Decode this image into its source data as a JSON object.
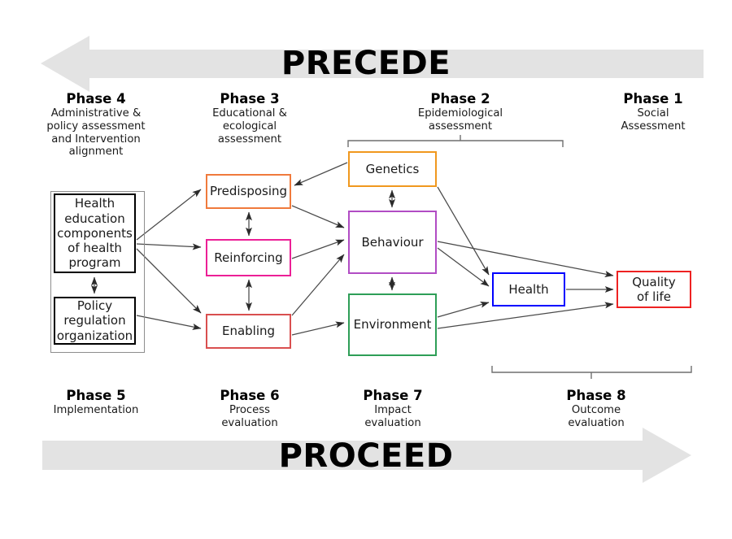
{
  "banners": {
    "top": {
      "label": "PRECEDE",
      "direction": "left",
      "color": "#e3e3e3"
    },
    "bottom": {
      "label": "PROCEED",
      "direction": "right",
      "color": "#e3e3e3"
    }
  },
  "phases_top": [
    {
      "title": "Phase 4",
      "subtitle": "Administrative &\npolicy assessment\nand Intervention\nalignment"
    },
    {
      "title": "Phase 3",
      "subtitle": "Educational &\necological\nassessment"
    },
    {
      "title": "Phase 2",
      "subtitle": "Epidemiological\nassessment"
    },
    {
      "title": "Phase 1",
      "subtitle": "Social\nAssessment"
    }
  ],
  "phases_bottom": [
    {
      "title": "Phase 5",
      "subtitle": "Implementation"
    },
    {
      "title": "Phase 6",
      "subtitle": "Process\nevaluation"
    },
    {
      "title": "Phase 7",
      "subtitle": "Impact\nevaluation"
    },
    {
      "title": "Phase 8",
      "subtitle": "Outcome\nevaluation"
    }
  ],
  "nodes": {
    "health_education": {
      "label": "Health\neducation\ncomponents\nof health\nprogram",
      "border_color": "#000000"
    },
    "policy_regulation": {
      "label": "Policy\nregulation\norganization",
      "border_color": "#000000"
    },
    "predisposing": {
      "label": "Predisposing",
      "border_color": "#f07a3c"
    },
    "reinforcing": {
      "label": "Reinforcing",
      "border_color": "#ec1f96"
    },
    "enabling": {
      "label": "Enabling",
      "border_color": "#d94f4f"
    },
    "genetics": {
      "label": "Genetics",
      "border_color": "#f0981e"
    },
    "behaviour": {
      "label": "Behaviour",
      "border_color": "#b14cc4"
    },
    "environment": {
      "label": "Environment",
      "border_color": "#2e9e57"
    },
    "health": {
      "label": "Health",
      "border_color": "#0000ff"
    },
    "quality_of_life": {
      "label": "Quality\nof life",
      "border_color": "#ee2222"
    }
  },
  "colors": {
    "arrow": "#4a4a4a",
    "bracket": "#6e6e6e",
    "banner": "#e3e3e3",
    "group_border": "#8d8d8d"
  }
}
